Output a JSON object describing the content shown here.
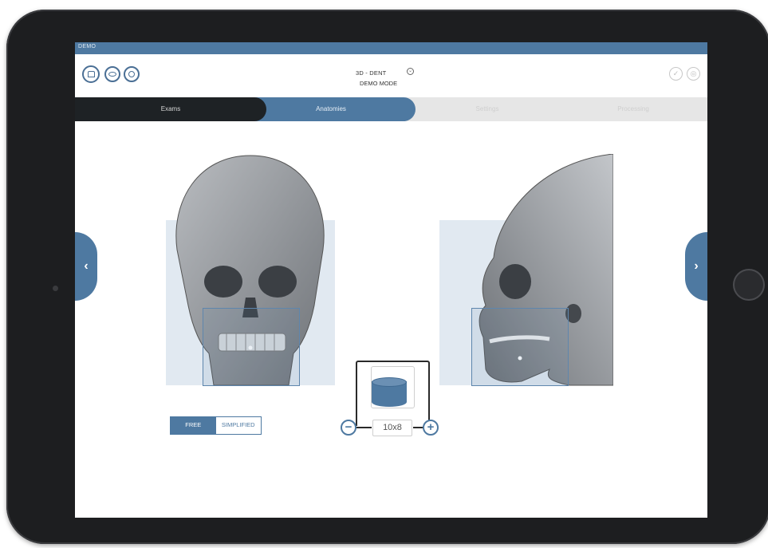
{
  "demo_strip": {
    "label": "DEMO"
  },
  "header": {
    "title": "3D - DENT",
    "subtitle": "DEMO MODE",
    "left_icons": [
      "home-icon",
      "eye-icon",
      "target-icon"
    ],
    "right_icons": [
      "check-icon",
      "globe-icon"
    ]
  },
  "tabs": [
    {
      "label": "Exams",
      "state": "completed"
    },
    {
      "label": "Anatomies",
      "state": "active"
    },
    {
      "label": "Settings",
      "state": "disabled"
    },
    {
      "label": "Processing",
      "state": "disabled"
    }
  ],
  "mode_toggle": {
    "free_label": "FREE",
    "simplified_label": "SIMPLIFIED",
    "selected": "FREE"
  },
  "fov": {
    "label": "10x8",
    "decrease_icon": "minus-icon",
    "increase_icon": "plus-icon",
    "icon": "cylinder-icon"
  },
  "navigation": {
    "prev_icon": "chevron-left-icon",
    "next_icon": "chevron-right-icon",
    "prev_glyph": "‹",
    "next_glyph": "›"
  },
  "colors": {
    "accent": "#4e79a1",
    "dark_tab": "#1e2225",
    "region": "#e1e9f1"
  }
}
